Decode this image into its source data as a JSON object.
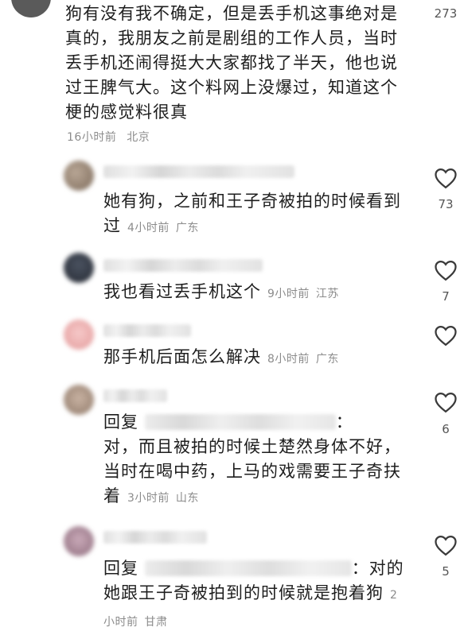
{
  "main_comment": {
    "text": "狗有没有我不确定，但是丢手机这事绝对是真的，我朋友之前是剧组的工作人员，当时丢手机还闹得挺大大家都找了半天，他也说过王脾气大。这个料网上没爆过，知道这个梗的感觉料很真",
    "time": "16小时前",
    "location": "北京",
    "like_count": "273"
  },
  "replies": [
    {
      "text": "她有狗，之前和王子奇被拍的时候看到过",
      "time": "4小时前",
      "location": "广东",
      "like_count": "73",
      "prefix": ""
    },
    {
      "text": "我也看过丢手机这个",
      "time": "9小时前",
      "location": "江苏",
      "like_count": "7",
      "prefix": ""
    },
    {
      "text": "那手机后面怎么解决",
      "time": "8小时前",
      "location": "广东",
      "like_count": "",
      "prefix": ""
    },
    {
      "prefix": "回复",
      "text": "对，而且被拍的时候土楚然身体不好，当时在喝中药，上马的戏需要王子奇扶着",
      "time": "3小时前",
      "location": "山东",
      "like_count": "6"
    },
    {
      "prefix": "回复",
      "text": "对的她跟王子奇被拍到的时候就是抱着狗",
      "time": "2小时前",
      "location": "甘肃",
      "like_count": "5"
    }
  ],
  "icons": {
    "like": "heart-outline-icon"
  },
  "colors": {
    "text": "#1e1e1e",
    "meta": "#8c8c8c",
    "heart_stroke": "#3a3a3a"
  }
}
